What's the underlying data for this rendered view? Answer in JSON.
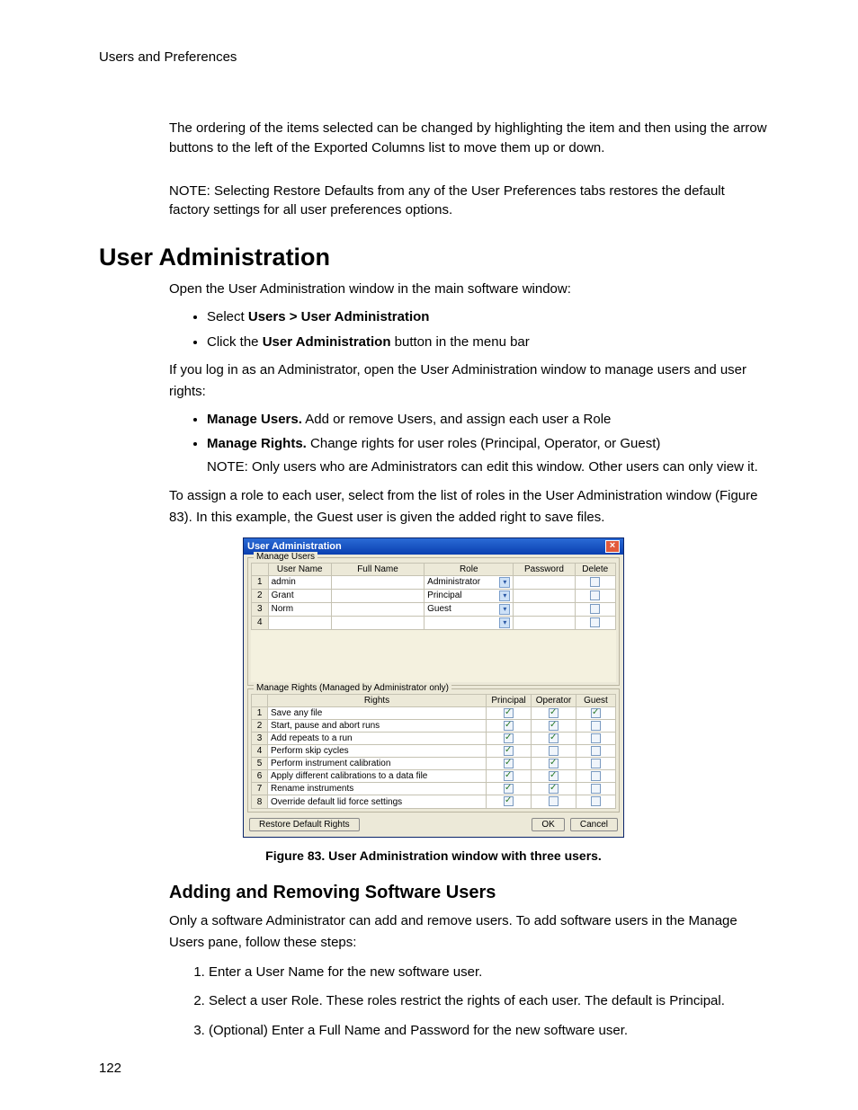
{
  "header": {
    "running": "Users and Preferences"
  },
  "footer": {
    "page_number": "122"
  },
  "body": {
    "p1": "The ordering of the items selected can be changed by highlighting the item and then using the arrow buttons to the left of the Exported Columns list to move them up or down.",
    "p2": "NOTE: Selecting Restore Defaults from any of the User Preferences tabs restores the default factory settings for all user preferences options.",
    "h1": "User Administration",
    "intro": "Open the User Administration window in the main software window:",
    "bullets1": [
      {
        "pre": "Select ",
        "b1": "Users > User Administration",
        "post": ""
      },
      {
        "pre": "Click the ",
        "b1": "User Administration",
        "post": " button in the menu bar"
      }
    ],
    "p3": "If you log in as an Administrator, open the User Administration window to manage users and user rights:",
    "bullets2": [
      {
        "b": "Manage Users.",
        "rest": " Add or remove Users, and assign each user a Role"
      },
      {
        "b": "Manage Rights.",
        "rest": " Change rights for user roles (Principal, Operator, or Guest)"
      }
    ],
    "note2": "NOTE: Only users who are Administrators can edit this window. Other users can only view it.",
    "p4": "To assign a role to each user, select from the list of roles in the User Administration window (Figure 83). In this example, the Guest user is given the added right to save files.",
    "figure_caption": "Figure 83. User Administration window with three users.",
    "h2": "Adding and Removing Software Users",
    "p5": "Only a software Administrator can add and remove users. To add software users in the Manage Users pane, follow these steps:",
    "steps": [
      "Enter a User Name for the new software user.",
      "Select a user Role. These roles restrict the rights of each user. The default is Principal.",
      "(Optional) Enter a Full Name and Password for the new software user."
    ]
  },
  "screenshot": {
    "title": "User Administration",
    "close_glyph": "×",
    "manage_users": {
      "label": "Manage Users",
      "columns": [
        "",
        "User Name",
        "Full Name",
        "Role",
        "Password",
        "Delete"
      ],
      "rows": [
        {
          "n": "1",
          "user": "admin",
          "role": "Administrator"
        },
        {
          "n": "2",
          "user": "Grant",
          "role": "Principal"
        },
        {
          "n": "3",
          "user": "Norm",
          "role": "Guest"
        },
        {
          "n": "4",
          "user": "",
          "role": ""
        }
      ]
    },
    "manage_rights": {
      "label": "Manage Rights (Managed by Administrator only)",
      "columns": [
        "",
        "Rights",
        "Principal",
        "Operator",
        "Guest"
      ],
      "rows": [
        {
          "n": "1",
          "right": "Save any file",
          "p": true,
          "o": true,
          "g": true
        },
        {
          "n": "2",
          "right": "Start, pause and abort runs",
          "p": true,
          "o": true,
          "g": false
        },
        {
          "n": "3",
          "right": "Add repeats to a run",
          "p": true,
          "o": true,
          "g": false
        },
        {
          "n": "4",
          "right": "Perform skip cycles",
          "p": true,
          "o": false,
          "g": false
        },
        {
          "n": "5",
          "right": "Perform instrument calibration",
          "p": true,
          "o": true,
          "g": false
        },
        {
          "n": "6",
          "right": "Apply different calibrations to a data file",
          "p": true,
          "o": true,
          "g": false
        },
        {
          "n": "7",
          "right": "Rename instruments",
          "p": true,
          "o": true,
          "g": false
        },
        {
          "n": "8",
          "right": "Override default lid force settings",
          "p": true,
          "o": false,
          "g": false
        }
      ]
    },
    "buttons": {
      "restore": "Restore Default Rights",
      "ok": "OK",
      "cancel": "Cancel"
    }
  }
}
